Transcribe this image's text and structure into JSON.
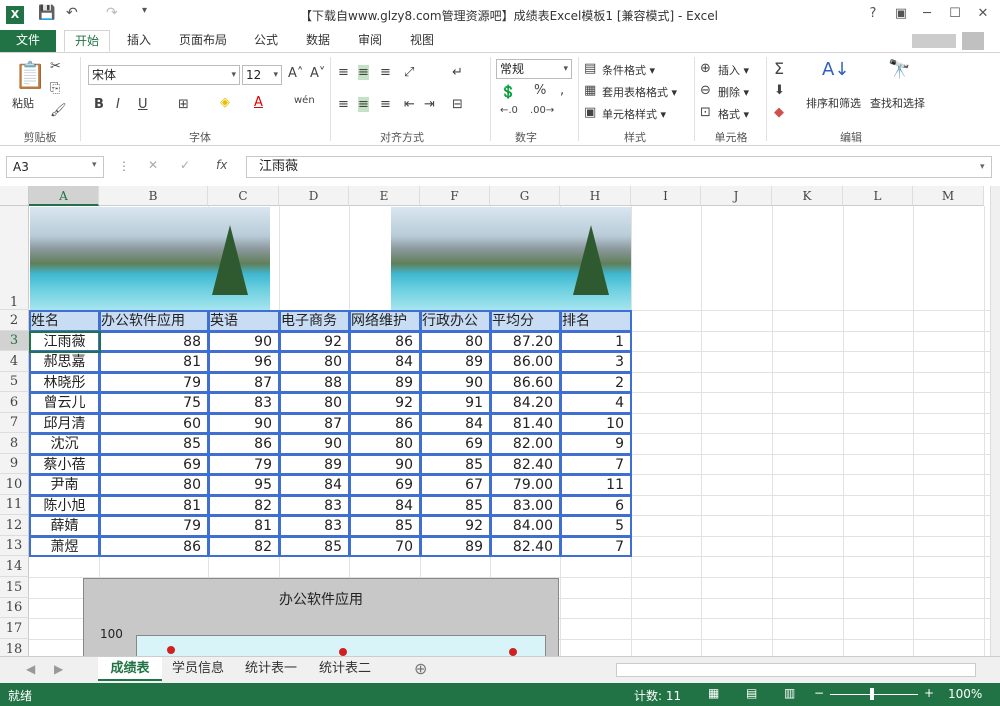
{
  "title": "【下载自www.glzy8.com管理资源吧】成绩表Excel模板1  [兼容模式] - Excel",
  "app_logo": "X",
  "ribbon_tabs": [
    "文件",
    "开始",
    "插入",
    "页面布局",
    "公式",
    "数据",
    "审阅",
    "视图"
  ],
  "ribbon": {
    "clipboard": {
      "paste": "粘贴",
      "label": "剪贴板"
    },
    "font": {
      "name": "宋体",
      "size": "12",
      "label": "字体",
      "bold": "B",
      "italic": "I",
      "underline": "U"
    },
    "align": {
      "label": "对齐方式"
    },
    "number": {
      "format": "常规",
      "label": "数字",
      "percent": "%"
    },
    "styles": {
      "cond": "条件格式 ▾",
      "table": "套用表格格式 ▾",
      "cell": "单元格样式 ▾",
      "label": "样式"
    },
    "cells": {
      "insert": "插入 ▾",
      "delete": "删除 ▾",
      "format": "格式 ▾",
      "label": "单元格"
    },
    "edit": {
      "sort": "排序和筛选",
      "find": "查找和选择",
      "label": "编辑"
    }
  },
  "formula_bar": {
    "name_box": "A3",
    "value": "江雨薇"
  },
  "columns": [
    "A",
    "B",
    "C",
    "D",
    "E",
    "F",
    "G",
    "H",
    "I",
    "J",
    "K",
    "L",
    "M"
  ],
  "rows": [
    "1",
    "2",
    "3",
    "4",
    "5",
    "6",
    "7",
    "8",
    "9",
    "10",
    "11",
    "12",
    "13",
    "14",
    "15",
    "16",
    "17",
    "18"
  ],
  "table": {
    "headers": [
      "姓名",
      "办公软件应用",
      "英语",
      "电子商务",
      "网络维护",
      "行政办公",
      "平均分",
      "排名"
    ],
    "data": [
      [
        "江雨薇",
        "88",
        "90",
        "92",
        "86",
        "80",
        "87.20",
        "1"
      ],
      [
        "郝思嘉",
        "81",
        "96",
        "80",
        "84",
        "89",
        "86.00",
        "3"
      ],
      [
        "林晓彤",
        "79",
        "87",
        "88",
        "89",
        "90",
        "86.60",
        "2"
      ],
      [
        "曾云儿",
        "75",
        "83",
        "80",
        "92",
        "91",
        "84.20",
        "4"
      ],
      [
        "邱月清",
        "60",
        "90",
        "87",
        "86",
        "84",
        "81.40",
        "10"
      ],
      [
        "沈沉",
        "85",
        "86",
        "90",
        "80",
        "69",
        "82.00",
        "9"
      ],
      [
        "蔡小蓓",
        "69",
        "79",
        "89",
        "90",
        "85",
        "82.40",
        "7"
      ],
      [
        "尹南",
        "80",
        "95",
        "84",
        "69",
        "67",
        "79.00",
        "11"
      ],
      [
        "陈小旭",
        "81",
        "82",
        "83",
        "84",
        "85",
        "83.00",
        "6"
      ],
      [
        "薛婧",
        "79",
        "81",
        "83",
        "85",
        "92",
        "84.00",
        "5"
      ],
      [
        "萧煜",
        "86",
        "82",
        "85",
        "70",
        "89",
        "82.40",
        "7"
      ]
    ]
  },
  "chart_data": {
    "type": "line",
    "title": "办公软件应用",
    "y_tick_visible": "100"
  },
  "sheet_tabs": [
    "成绩表",
    "学员信息",
    "统计表一",
    "统计表二"
  ],
  "status": {
    "ready": "就绪",
    "count": "计数: 11",
    "zoom": "100%"
  }
}
